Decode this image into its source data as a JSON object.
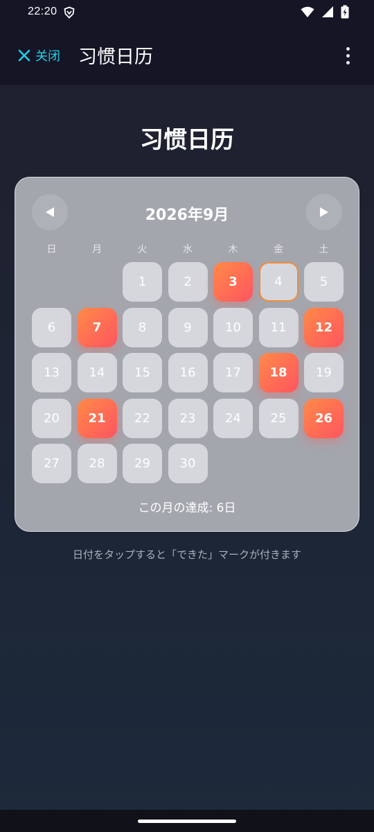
{
  "status_bar": {
    "time": "22:20"
  },
  "app_bar": {
    "close_label": "关闭",
    "title": "习惯日历"
  },
  "page": {
    "heading": "习惯日历",
    "hint": "日付をタップすると「できた」マークが付きます"
  },
  "calendar": {
    "month_label": "2026年9月",
    "weekdays": [
      "日",
      "月",
      "火",
      "水",
      "木",
      "金",
      "土"
    ],
    "leading_blanks": 2,
    "days": [
      {
        "label": "1",
        "state": "normal"
      },
      {
        "label": "2",
        "state": "normal"
      },
      {
        "label": "3",
        "state": "done"
      },
      {
        "label": "4",
        "state": "today"
      },
      {
        "label": "5",
        "state": "normal"
      },
      {
        "label": "6",
        "state": "normal"
      },
      {
        "label": "7",
        "state": "done"
      },
      {
        "label": "8",
        "state": "normal"
      },
      {
        "label": "9",
        "state": "normal"
      },
      {
        "label": "10",
        "state": "normal"
      },
      {
        "label": "11",
        "state": "normal"
      },
      {
        "label": "12",
        "state": "done"
      },
      {
        "label": "13",
        "state": "normal"
      },
      {
        "label": "14",
        "state": "normal"
      },
      {
        "label": "15",
        "state": "normal"
      },
      {
        "label": "16",
        "state": "normal"
      },
      {
        "label": "17",
        "state": "normal"
      },
      {
        "label": "18",
        "state": "done"
      },
      {
        "label": "19",
        "state": "normal"
      },
      {
        "label": "20",
        "state": "normal"
      },
      {
        "label": "21",
        "state": "done"
      },
      {
        "label": "22",
        "state": "normal"
      },
      {
        "label": "23",
        "state": "normal"
      },
      {
        "label": "24",
        "state": "normal"
      },
      {
        "label": "25",
        "state": "normal"
      },
      {
        "label": "26",
        "state": "done"
      },
      {
        "label": "27",
        "state": "normal"
      },
      {
        "label": "28",
        "state": "normal"
      },
      {
        "label": "29",
        "state": "normal"
      },
      {
        "label": "30",
        "state": "normal"
      }
    ],
    "summary": "この月の達成: 6日"
  },
  "colors": {
    "accent": "#21d0e5",
    "done_start": "#ff8a47",
    "done_end": "#ff5560",
    "today_border": "#f08b3c",
    "card_bg": "#a4a6ae",
    "cell_bg": "#d6d7dc"
  },
  "icons": {
    "close": "close-x-icon",
    "more": "more-vertical-icon",
    "prev": "triangle-left-icon",
    "next": "triangle-right-icon"
  }
}
